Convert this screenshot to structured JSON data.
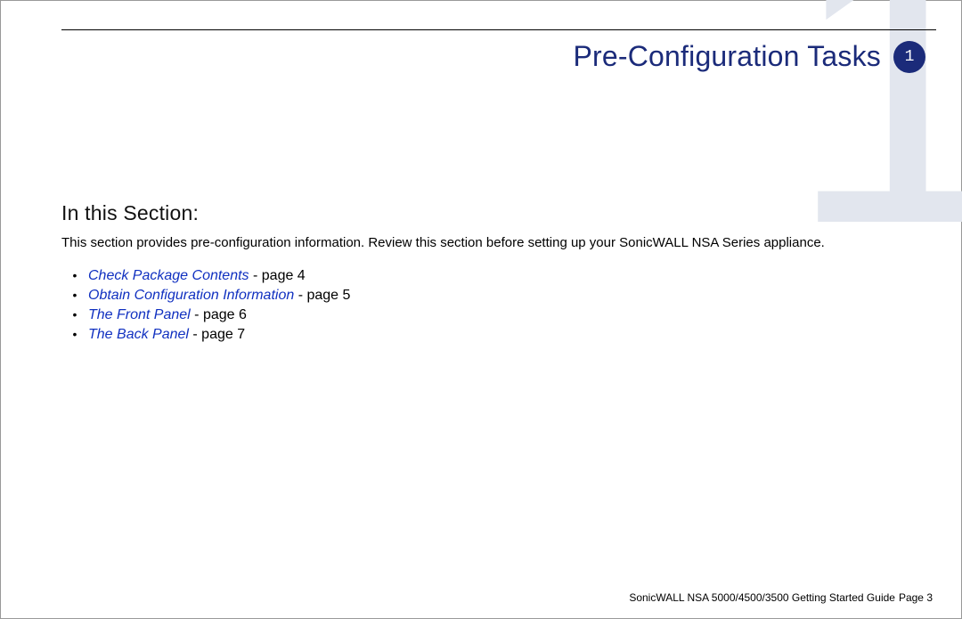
{
  "chapter": {
    "title": "Pre-Configuration Tasks",
    "badge_number": "1",
    "bg_number": "1"
  },
  "section": {
    "heading": "In this Section:",
    "intro": "This section provides pre-configuration information. Review this section before setting up your SonicWALL NSA Series appliance.",
    "items": [
      {
        "link": "Check Package Contents",
        "suffix": " - page 4"
      },
      {
        "link": "Obtain Configuration Information",
        "suffix": " - page 5"
      },
      {
        "link": "The Front Panel",
        "suffix": " - page 6"
      },
      {
        "link": "The Back Panel",
        "suffix": " - page 7"
      }
    ]
  },
  "footer": {
    "guide": "SonicWALL NSA 5000/4500/3500 Getting Started Guide",
    "page_label": "  Page 3"
  }
}
